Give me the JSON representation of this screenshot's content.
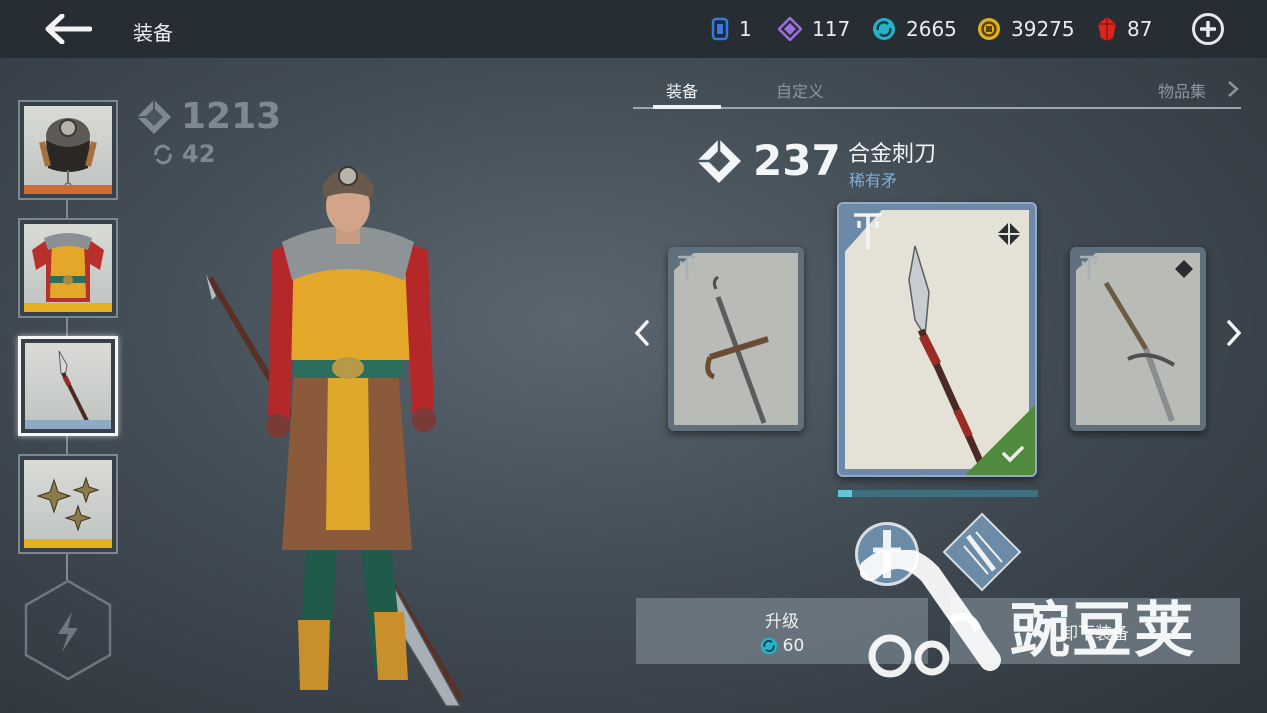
{
  "header": {
    "title": "装备",
    "currencies": [
      {
        "icon": "card-token-icon",
        "value": "1",
        "color": "#3a7bd5"
      },
      {
        "icon": "diamond-gem-icon",
        "value": "117",
        "color": "#9b6fe0"
      },
      {
        "icon": "swirl-orb-icon",
        "value": "2665",
        "color": "#27b2c9"
      },
      {
        "icon": "gold-coin-icon",
        "value": "39275",
        "color": "#e0b11e"
      },
      {
        "icon": "red-ruby-icon",
        "value": "87",
        "color": "#d8261e"
      }
    ]
  },
  "stats": {
    "total_power": "1213",
    "upgrade_level": "42"
  },
  "slots": [
    {
      "name": "helmet",
      "bar_color": "#d06d33"
    },
    {
      "name": "armor",
      "bar_color": "#e4b01e"
    },
    {
      "name": "spear",
      "bar_color": "#8eaac4"
    },
    {
      "name": "shuriken",
      "bar_color": "#e4b01e"
    }
  ],
  "tabs": {
    "equipment": "装备",
    "customize": "自定义",
    "collection": "物品集"
  },
  "item": {
    "power": "237",
    "name": "合金刺刀",
    "rarity": "稀有矛",
    "upgrade_progress": 0.07
  },
  "actions": {
    "upgrade_label": "升级",
    "upgrade_cost": "60",
    "unequip_label": "卸下装备"
  },
  "watermark": {
    "text": "豌豆荚"
  }
}
